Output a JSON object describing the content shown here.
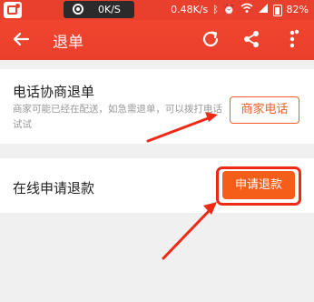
{
  "status_bar": {
    "net_speed_center": "0K/S",
    "net_speed_right": "0.48K/s",
    "battery": "82%"
  },
  "header": {
    "title": "退单"
  },
  "phone_refund": {
    "title": "电话协商退单",
    "description": "商家可能已经在配送，如急需退单，可以拨打电话试试",
    "button_label": "商家电话"
  },
  "online_refund": {
    "title": "在线申请退款",
    "button_label": "申请退款"
  },
  "colors": {
    "header_red": "#ea3f2b",
    "accent_orange": "#f45e18",
    "annotation_red": "#ee2a16"
  }
}
